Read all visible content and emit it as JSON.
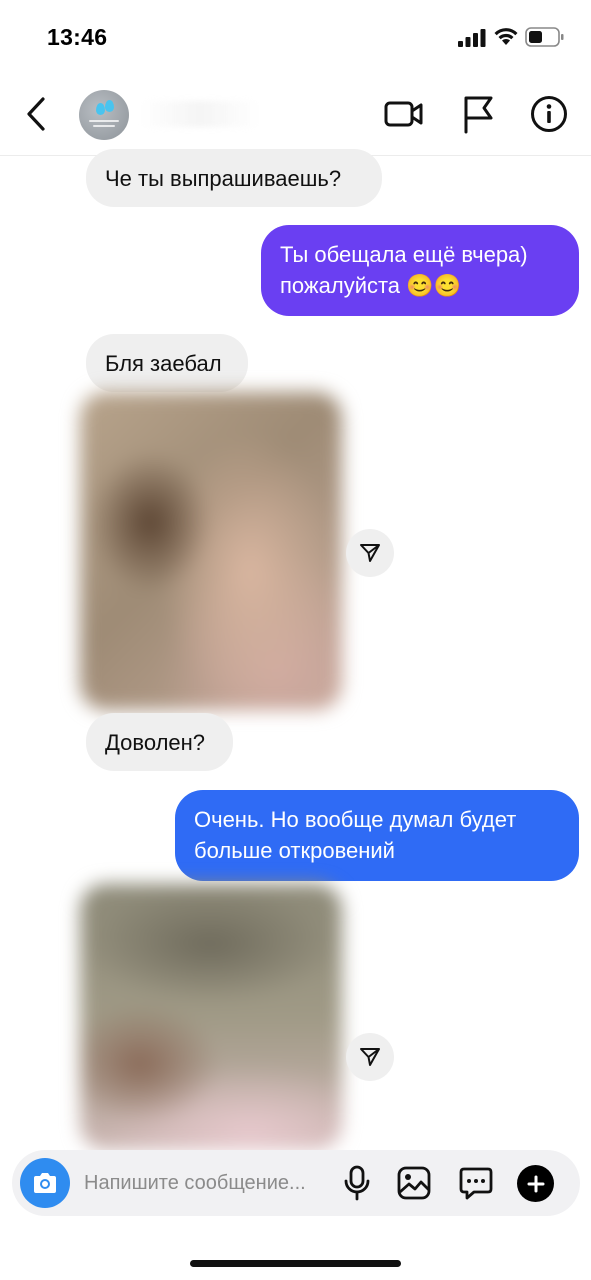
{
  "status_bar": {
    "time": "13:46"
  },
  "header": {
    "back_icon": "chevron-left-icon",
    "avatar_icon": "avatar-logo",
    "video_icon": "video-camera-icon",
    "report_icon": "flag-icon",
    "info_icon": "info-icon"
  },
  "messages": [
    {
      "direction": "incoming",
      "text": "Че ты выпрашиваешь?"
    },
    {
      "direction": "outgoing",
      "text_line1": "Ты обещала ещё вчера)",
      "text_line2": "пожалуйста 😊😊",
      "color": "#6a3ff2"
    },
    {
      "direction": "incoming",
      "text": "Бля заебал"
    },
    {
      "direction": "incoming",
      "type": "photo",
      "share_icon": "send-icon"
    },
    {
      "direction": "incoming",
      "text": "Доволен?"
    },
    {
      "direction": "outgoing",
      "text_line1": "Очень. Но вообще думал будет",
      "text_line2": "больше откровений",
      "color": "#2f6bf5"
    },
    {
      "direction": "incoming",
      "type": "photo",
      "share_icon": "send-icon"
    }
  ],
  "composer": {
    "placeholder": "Напишите сообщение...",
    "camera_icon": "camera-icon",
    "mic_icon": "microphone-icon",
    "gallery_icon": "image-icon",
    "sticker_icon": "sticker-chat-icon",
    "add_icon": "plus-icon"
  },
  "colors": {
    "outgoing_purple": "#6a3ff2",
    "outgoing_blue": "#2f6bf5",
    "incoming_bg": "#efefef",
    "camera_blue": "#2f8cf0"
  }
}
